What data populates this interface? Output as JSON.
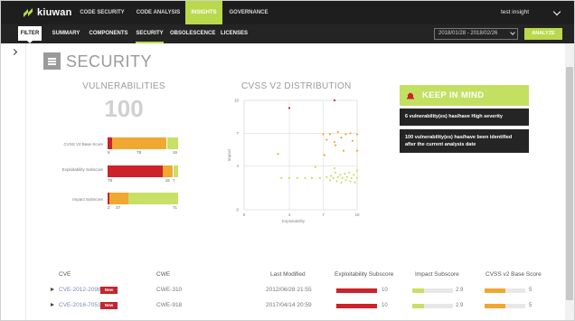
{
  "app": {
    "name": "kiuwan"
  },
  "top_nav": [
    {
      "label": "CODE SECURITY",
      "active": false
    },
    {
      "label": "CODE ANALYSIS",
      "active": false
    },
    {
      "label": "INSIGHTS",
      "active": true
    },
    {
      "label": "GOVERNANCE",
      "active": false
    }
  ],
  "user": {
    "name": "test insight"
  },
  "sub_nav": {
    "filter_label": "FILTER",
    "items": [
      {
        "label": "SUMMARY",
        "active": false
      },
      {
        "label": "COMPONENTS",
        "active": false
      },
      {
        "label": "SECURITY",
        "active": true
      },
      {
        "label": "OBSOLESCENCE",
        "active": false
      },
      {
        "label": "LICENSES",
        "active": false
      }
    ],
    "date_range": "2018/01/28 - 2018/02/26",
    "analyze_label": "ANALYZE"
  },
  "page": {
    "title": "SECURITY"
  },
  "vulnerabilities": {
    "title": "VULNERABILITIES",
    "count": "100",
    "breakdown": [
      {
        "label": "CVSS V2 Base Score",
        "segments": [
          {
            "color": "#cc2229",
            "value": 6
          },
          {
            "color": "#f0a830",
            "value": 78
          },
          {
            "color": "#c8e065",
            "value": 16
          }
        ],
        "labels": [
          "6",
          "78",
          "16"
        ]
      },
      {
        "label": "Exploitability Subscore",
        "segments": [
          {
            "color": "#cc2229",
            "value": 78
          },
          {
            "color": "#f0a830",
            "value": 15
          },
          {
            "color": "#c8e065",
            "value": 7
          }
        ],
        "labels": [
          "78",
          "15",
          "7"
        ]
      },
      {
        "label": "Impact Subscore",
        "segments": [
          {
            "color": "#cc2229",
            "value": 2
          },
          {
            "color": "#f0a830",
            "value": 27
          },
          {
            "color": "#c8e065",
            "value": 71
          }
        ],
        "labels": [
          "2",
          "27",
          "71"
        ]
      }
    ]
  },
  "cvss_chart": {
    "title": "CVSS V2 DISTRIBUTION",
    "chart_data": {
      "type": "scatter",
      "title": "CVSS V2 DISTRIBUTION",
      "xlabel": "Exploitability",
      "ylabel": "Impact",
      "xlim": [
        0,
        10
      ],
      "ylim": [
        0,
        10
      ],
      "x_ticks": [
        "0",
        "4",
        "7",
        "10"
      ],
      "y_ticks": [
        "0",
        "4",
        "7",
        "10"
      ],
      "grid": true,
      "series": [
        {
          "color": "#cc2229",
          "points": [
            [
              4.0,
              9.3
            ],
            [
              8.0,
              10.0
            ]
          ]
        },
        {
          "color": "#f0a830",
          "points": [
            [
              7.0,
              6.9
            ],
            [
              7.3,
              6.4
            ],
            [
              7.6,
              6.9
            ],
            [
              8.0,
              6.2
            ],
            [
              8.3,
              7.1
            ],
            [
              8.6,
              6.6
            ],
            [
              9.0,
              6.9
            ],
            [
              9.4,
              7.0
            ],
            [
              9.6,
              6.3
            ],
            [
              10.0,
              6.9
            ],
            [
              8.1,
              5.9
            ],
            [
              8.8,
              5.4
            ],
            [
              3.0,
              5.1
            ],
            [
              7.1,
              5.0
            ],
            [
              10.0,
              5.4
            ]
          ]
        },
        {
          "color": "#c8e065",
          "points": [
            [
              3.3,
              2.9
            ],
            [
              4.0,
              2.9
            ],
            [
              4.7,
              2.9
            ],
            [
              5.4,
              2.9
            ],
            [
              6.0,
              2.9
            ],
            [
              6.7,
              2.9
            ],
            [
              7.3,
              3.0
            ],
            [
              7.7,
              3.1
            ],
            [
              7.9,
              2.9
            ],
            [
              8.1,
              3.4
            ],
            [
              8.3,
              3.0
            ],
            [
              8.5,
              3.2
            ],
            [
              8.7,
              2.9
            ],
            [
              8.9,
              3.3
            ],
            [
              9.1,
              3.0
            ],
            [
              9.3,
              3.4
            ],
            [
              9.5,
              2.9
            ],
            [
              9.7,
              3.2
            ],
            [
              10.0,
              2.9
            ],
            [
              8.2,
              2.6
            ],
            [
              8.6,
              2.5
            ],
            [
              9.0,
              2.7
            ],
            [
              9.4,
              2.6
            ],
            [
              9.8,
              2.5
            ],
            [
              7.6,
              2.7
            ],
            [
              10.0,
              3.6
            ],
            [
              6.3,
              3.9
            ],
            [
              8.0,
              3.8
            ]
          ]
        }
      ]
    }
  },
  "keep_in_mind": {
    "title": "KEEP IN MIND",
    "cards": [
      "6 vulnerability(es) has/have High severity",
      "100 vulnerability(es) has/have been identified after the current analysis date"
    ]
  },
  "table": {
    "headers": {
      "cve": "CVE",
      "cwe": "CWE",
      "modified": "Last Modified",
      "exploit": "Exploitability Subscore",
      "impact": "Impact Subscore",
      "cvss": "CVSS v2 Base Score"
    },
    "new_label": "New",
    "rows": [
      {
        "cve": "CVE-2012-2098",
        "cwe": "CWE-310",
        "modified": "2012/06/28 21:55",
        "exploit": 10,
        "exploit_label": "10",
        "exploit_color": "#cc2229",
        "impact": 2.9,
        "impact_label": "2.9",
        "impact_color": "#c8e065",
        "cvss": 5,
        "cvss_label": "5",
        "cvss_color": "#f0a830"
      },
      {
        "cve": "CVE-2016-7051",
        "cwe": "CWE-918",
        "modified": "2017/04/14 20:59",
        "exploit": 10,
        "exploit_label": "10",
        "exploit_color": "#cc2229",
        "impact": 2.9,
        "impact_label": "2.9",
        "impact_color": "#c8e065",
        "cvss": 5,
        "cvss_label": "5",
        "cvss_color": "#f0a830"
      }
    ]
  },
  "colors": {
    "accent": "#b9d94c",
    "high": "#cc2229",
    "medium": "#f0a830",
    "low": "#c8e065",
    "nav_bg": "#1e1e1e"
  }
}
